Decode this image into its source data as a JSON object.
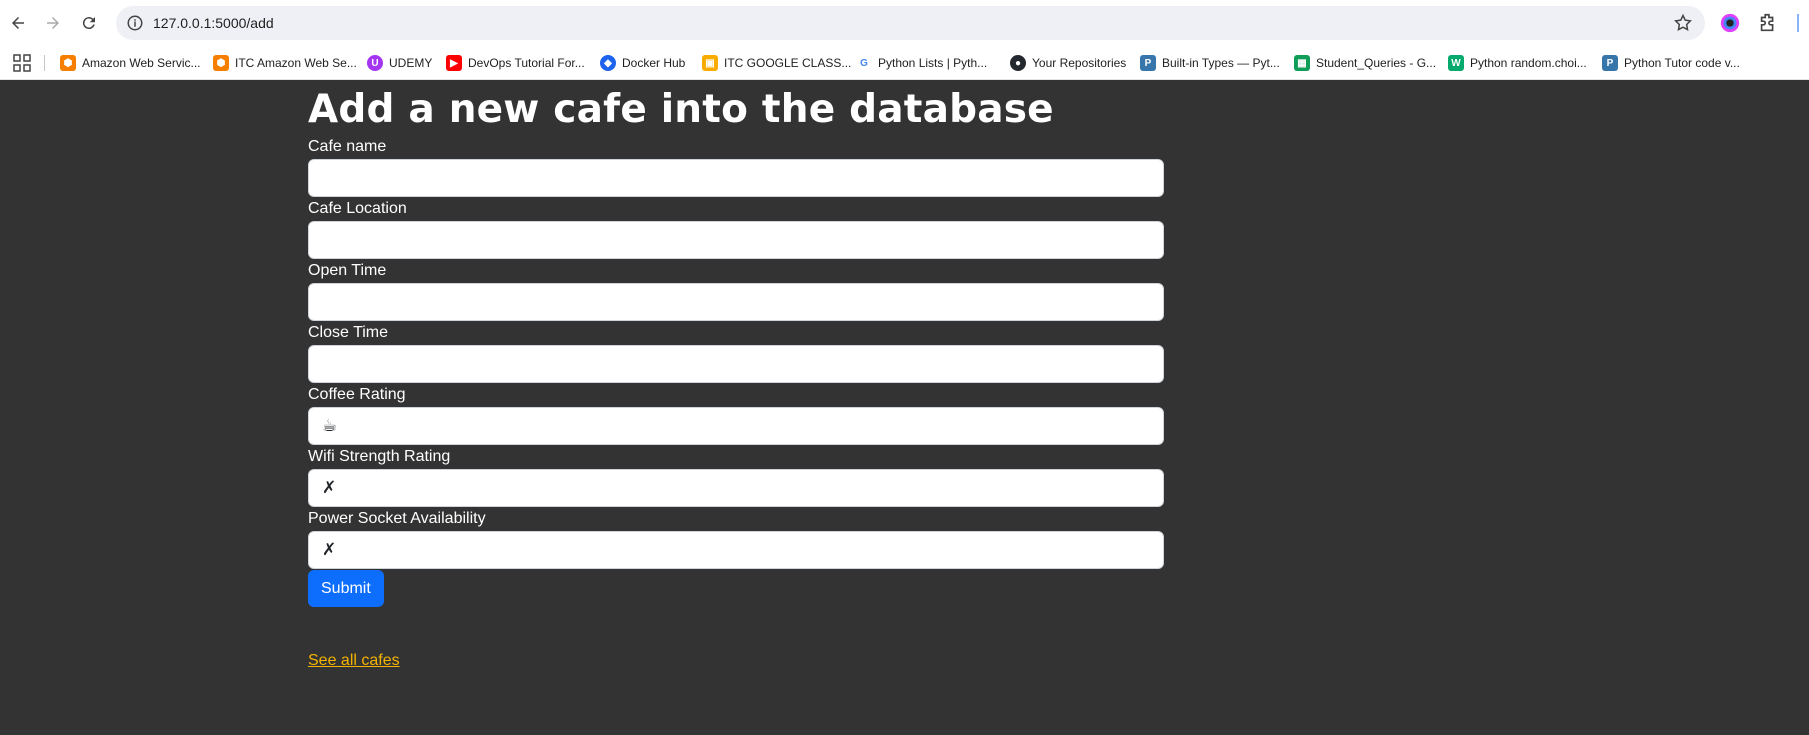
{
  "browser": {
    "url": "127.0.0.1:5000/add",
    "bookmarks": [
      {
        "label": "Amazon Web Servic...",
        "icon": "aws-icon",
        "color": "#f77f00"
      },
      {
        "label": "ITC Amazon Web Se...",
        "icon": "aws-icon",
        "color": "#f77f00"
      },
      {
        "label": "UDEMY",
        "icon": "udemy-icon",
        "color": "#a435f0"
      },
      {
        "label": "DevOps Tutorial For...",
        "icon": "youtube-icon",
        "color": "#ff0000"
      },
      {
        "label": "Docker Hub",
        "icon": "docker-icon",
        "color": "#1d63ed"
      },
      {
        "label": "ITC GOOGLE CLASS...",
        "icon": "google-classroom-icon",
        "color": "#f9ab00"
      },
      {
        "label": "Python Lists | Pyth...",
        "icon": "google-icon",
        "color": "#4285f4"
      },
      {
        "label": "Your Repositories",
        "icon": "github-icon",
        "color": "#24292f"
      },
      {
        "label": "Built-in Types — Pyt...",
        "icon": "python-icon",
        "color": "#3776ab"
      },
      {
        "label": "Student_Queries - G...",
        "icon": "google-sheets-icon",
        "color": "#0f9d58"
      },
      {
        "label": "Python random.choi...",
        "icon": "w3schools-icon",
        "color": "#04aa6d"
      },
      {
        "label": "Python Tutor code v...",
        "icon": "python-icon",
        "color": "#3776ab"
      }
    ]
  },
  "page": {
    "title": "Add a new cafe into the database",
    "fields": [
      {
        "label": "Cafe name",
        "value": ""
      },
      {
        "label": "Cafe Location",
        "value": ""
      },
      {
        "label": "Open Time",
        "value": ""
      },
      {
        "label": "Close Time",
        "value": ""
      },
      {
        "label": "Coffee Rating",
        "value": "☕"
      },
      {
        "label": "Wifi Strength Rating",
        "value": "✗"
      },
      {
        "label": "Power Socket Availability",
        "value": "✗"
      }
    ],
    "submit_label": "Submit",
    "see_all_link": "See all cafes"
  },
  "colors": {
    "background": "#333333",
    "submit": "#0d6efd",
    "link": "#f5b301"
  }
}
